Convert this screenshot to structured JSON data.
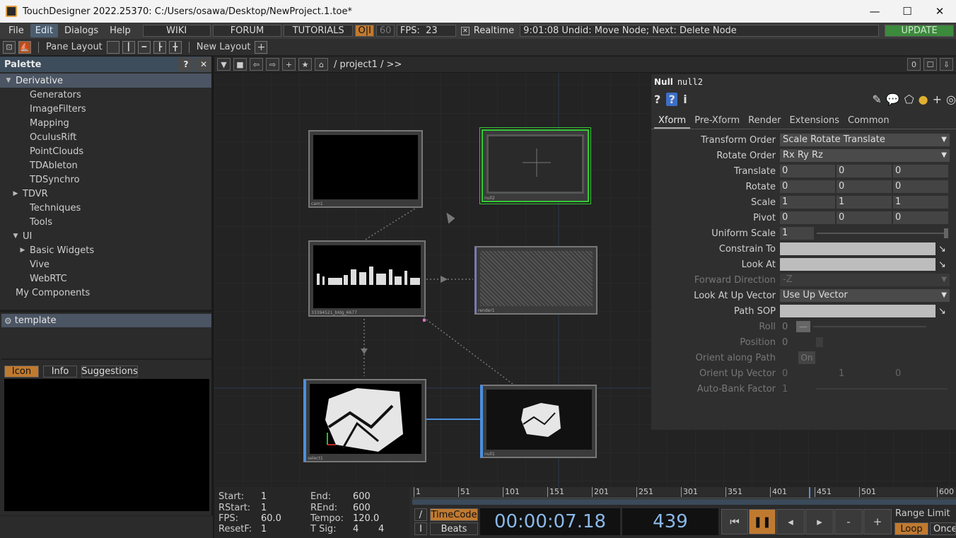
{
  "window": {
    "title": "TouchDesigner 2022.25370: C:/Users/osawa/Desktop/NewProject.1.toe*",
    "min": "—",
    "max": "☐",
    "close": "✕"
  },
  "menu": {
    "file": "File",
    "edit": "Edit",
    "dialogs": "Dialogs",
    "help": "Help",
    "wiki": "WIKI",
    "forum": "FORUM",
    "tutorials": "TUTORIALS",
    "oi": "O|I",
    "fps_cap": "60",
    "fps_label": "FPS:",
    "fps_value": "23",
    "realtime_check": "✕",
    "realtime": "Realtime",
    "status": "9:01:08 Undid: Move Node; Next: Delete Node",
    "update": "UPDATE"
  },
  "toolbar": {
    "pane_layout": "Pane Layout",
    "new_layout": "New Layout",
    "plus": "+"
  },
  "palette": {
    "title": "Palette",
    "help": "?",
    "close": "✕",
    "items": [
      {
        "label": "Derivative",
        "indent": 0,
        "tri": "▼",
        "sel": true
      },
      {
        "label": "Generators",
        "indent": 2,
        "tri": ""
      },
      {
        "label": "ImageFilters",
        "indent": 2,
        "tri": ""
      },
      {
        "label": "Mapping",
        "indent": 2,
        "tri": ""
      },
      {
        "label": "OculusRift",
        "indent": 2,
        "tri": ""
      },
      {
        "label": "PointClouds",
        "indent": 2,
        "tri": ""
      },
      {
        "label": "TDAbleton",
        "indent": 2,
        "tri": ""
      },
      {
        "label": "TDSynchro",
        "indent": 2,
        "tri": ""
      },
      {
        "label": "TDVR",
        "indent": 1,
        "tri": "▶"
      },
      {
        "label": "Techniques",
        "indent": 2,
        "tri": ""
      },
      {
        "label": "Tools",
        "indent": 2,
        "tri": ""
      },
      {
        "label": "UI",
        "indent": 1,
        "tri": "▼"
      },
      {
        "label": "Basic Widgets",
        "indent": 2,
        "tri": "▶"
      },
      {
        "label": "Vive",
        "indent": 2,
        "tri": ""
      },
      {
        "label": "WebRTC",
        "indent": 2,
        "tri": ""
      },
      {
        "label": "My Components",
        "indent": 0,
        "tri": ""
      }
    ],
    "template": "template",
    "tab_icon": "Icon",
    "tab_info": "Info",
    "tab_suggestions": "Suggestions"
  },
  "network": {
    "path": "/ project1 / >>",
    "right_num": "0",
    "nodes": [
      {
        "label": "cam1"
      },
      {
        "label": "null2"
      },
      {
        "label": "33394521_bldg_6677"
      },
      {
        "label": "render1"
      },
      {
        "label": "select1"
      },
      {
        "label": "null1"
      }
    ]
  },
  "params": {
    "optype": "Null",
    "opname": "null2",
    "tabs": [
      "Xform",
      "Pre-Xform",
      "Render",
      "Extensions",
      "Common"
    ],
    "transform_order": {
      "label": "Transform Order",
      "value": "Scale Rotate Translate"
    },
    "rotate_order": {
      "label": "Rotate Order",
      "value": "Rx Ry Rz"
    },
    "translate": {
      "label": "Translate",
      "x": "0",
      "y": "0",
      "z": "0"
    },
    "rotate": {
      "label": "Rotate",
      "x": "0",
      "y": "0",
      "z": "0"
    },
    "scale": {
      "label": "Scale",
      "x": "1",
      "y": "1",
      "z": "1"
    },
    "pivot": {
      "label": "Pivot",
      "x": "0",
      "y": "0",
      "z": "0"
    },
    "uniform_scale": {
      "label": "Uniform Scale",
      "value": "1"
    },
    "constrain_to": {
      "label": "Constrain To"
    },
    "look_at": {
      "label": "Look At"
    },
    "forward_direction": {
      "label": "Forward Direction",
      "value": "-Z"
    },
    "look_at_up": {
      "label": "Look At Up Vector",
      "value": "Use Up Vector"
    },
    "path_sop": {
      "label": "Path SOP"
    },
    "roll": {
      "label": "Roll",
      "value": "0"
    },
    "position": {
      "label": "Position",
      "value": "0"
    },
    "orient_path": {
      "label": "Orient along Path",
      "value": "On"
    },
    "orient_up": {
      "label": "Orient Up Vector",
      "x": "0",
      "y": "1",
      "z": "0"
    },
    "autobank": {
      "label": "Auto-Bank Factor",
      "value": "1"
    }
  },
  "timeline": {
    "start_k": "Start:",
    "start_v": "1",
    "end_k": "End:",
    "end_v": "600",
    "rstart_k": "RStart:",
    "rstart_v": "1",
    "rend_k": "REnd:",
    "rend_v": "600",
    "fps_k": "FPS:",
    "fps_v": "60.0",
    "tempo_k": "Tempo:",
    "tempo_v": "120.0",
    "resetf_k": "ResetF:",
    "resetf_v": "1",
    "tsig_k": "T Sig:",
    "tsig_v1": "4",
    "tsig_v2": "4",
    "ticks": [
      "1",
      "51",
      "101",
      "151",
      "201",
      "251",
      "301",
      "351",
      "401",
      "451",
      "501",
      "600"
    ],
    "timecode": "TimeCode",
    "beats": "Beats",
    "time": "00:00:07.18",
    "frame": "439",
    "range_limit": "Range Limit",
    "loop": "Loop",
    "once": "Once",
    "minus": "-",
    "plus": "+"
  }
}
